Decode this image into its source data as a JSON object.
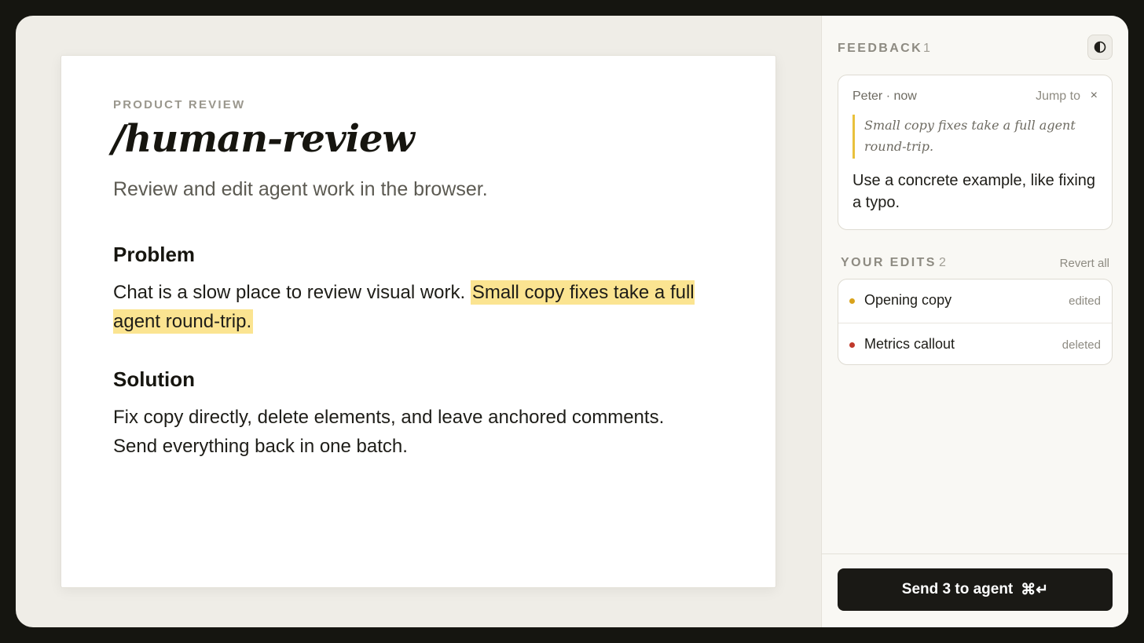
{
  "document": {
    "eyebrow": "PRODUCT REVIEW",
    "title": "/human-review",
    "subtitle": "Review and edit agent work in the browser.",
    "sections": [
      {
        "heading": "Problem",
        "text_before": "Chat is a slow place to review visual work.",
        "highlight": "Small copy fixes take a full agent round-trip."
      },
      {
        "heading": "Solution",
        "text": "Fix copy directly, delete elements, and leave anchored comments. Send everything back in one batch."
      }
    ]
  },
  "sidebar": {
    "feedback": {
      "label": "FEEDBACK",
      "count": "1",
      "items": [
        {
          "author": "Peter · now",
          "jump_label": "Jump to",
          "close_glyph": "×",
          "quote": "Small copy fixes take a full agent round-trip.",
          "comment": "Use a concrete example, like fixing a typo."
        }
      ]
    },
    "edits": {
      "label": "YOUR EDITS",
      "count": "2",
      "revert_label": "Revert all",
      "items": [
        {
          "name": "Opening copy",
          "status": "edited",
          "color": "#d9a21b"
        },
        {
          "name": "Metrics callout",
          "status": "deleted",
          "color": "#c0392b"
        }
      ]
    },
    "send_button": {
      "label": "Send 3 to agent",
      "shortcut": "⌘↵"
    },
    "theme_toggle_icon": "contrast-icon"
  },
  "colors": {
    "highlight": "#fbe491",
    "quote_bar": "#e9c13c",
    "button_bg": "#1a1915"
  }
}
